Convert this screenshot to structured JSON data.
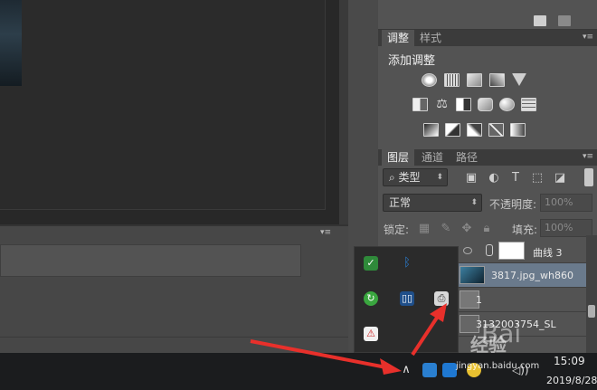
{
  "adjustments_panel": {
    "tabs": [
      "调整",
      "样式"
    ],
    "title": "添加调整",
    "menu_glyph": "▾≡"
  },
  "layers_panel": {
    "tabs": [
      "图层",
      "通道",
      "路径"
    ],
    "filter_label": "类型",
    "blend_mode": "正常",
    "opacity_label": "不透明度:",
    "opacity_value": "100%",
    "lock_label": "锁定:",
    "fill_label": "填充:",
    "fill_value": "100%",
    "layers": [
      {
        "name": "曲线 3"
      },
      {
        "name": "3817.jpg_wh860",
        "selected": true
      },
      {
        "name": "1"
      },
      {
        "name": "3132003754_SL"
      }
    ]
  },
  "tray_popup": {
    "icons": [
      "shield-green-icon",
      "bluetooth-icon",
      "update-icon",
      "display-icon",
      "printer-icon",
      "security-warning-icon"
    ]
  },
  "taskbar": {
    "show_hidden_glyph": "∧",
    "time": "15:09",
    "date": "2019/8/28",
    "volume_glyph": "◁))"
  },
  "watermark": {
    "text": "经验",
    "url": "jingyan.baidu.com",
    "paw": "Bai"
  },
  "colors": {
    "panel_bg": "#535353",
    "tab_bar_bg": "#3b3b3b",
    "selected_layer": "#6a7a8c",
    "taskbar_bg": "#1b1c1e",
    "arrow_red": "#e8302b"
  }
}
